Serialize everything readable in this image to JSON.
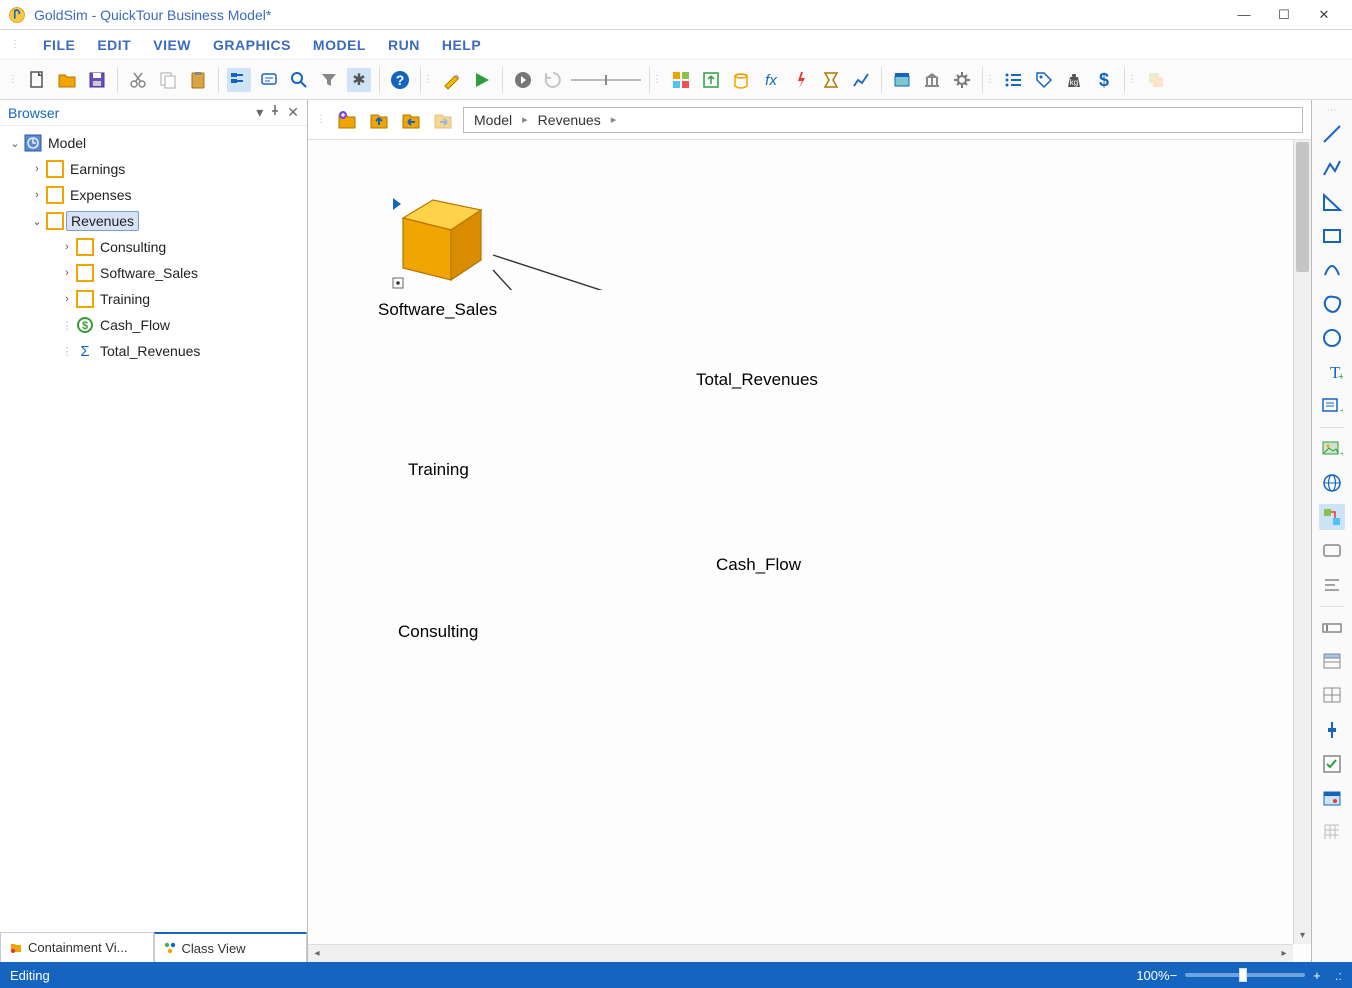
{
  "window": {
    "title": "GoldSim  - QuickTour Business Model*"
  },
  "menu": {
    "items": [
      "FILE",
      "EDIT",
      "VIEW",
      "GRAPHICS",
      "MODEL",
      "RUN",
      "HELP"
    ]
  },
  "sidebar": {
    "title": "Browser",
    "tabs": {
      "containment": "Containment Vi...",
      "class": "Class View"
    }
  },
  "tree": {
    "root": "Model",
    "items": [
      {
        "label": "Earnings",
        "hasChildren": true
      },
      {
        "label": "Expenses",
        "hasChildren": true
      },
      {
        "label": "Revenues",
        "hasChildren": true,
        "selected": true,
        "children": [
          {
            "label": "Consulting",
            "type": "container",
            "hasChildren": true
          },
          {
            "label": "Software_Sales",
            "type": "container",
            "hasChildren": true
          },
          {
            "label": "Training",
            "type": "container",
            "hasChildren": true
          },
          {
            "label": "Cash_Flow",
            "type": "cashflow"
          },
          {
            "label": "Total_Revenues",
            "type": "sum"
          }
        ]
      }
    ]
  },
  "breadcrumb": {
    "items": [
      "Model",
      "Revenues"
    ]
  },
  "canvas": {
    "nodes": {
      "software_sales": "Software_Sales",
      "training": "Training",
      "consulting": "Consulting",
      "total_revenues": "Total_Revenues",
      "cash_flow": "Cash_Flow"
    }
  },
  "status": {
    "mode": "Editing",
    "zoom": "100%"
  }
}
